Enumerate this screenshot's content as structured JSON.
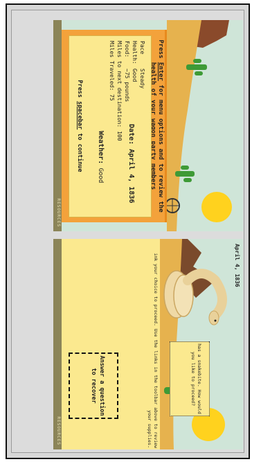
{
  "screen_travel": {
    "prompt_prefix": "Press ",
    "prompt_key": "Enter",
    "prompt_suffix": " for menu options and to review the health of your wagon party members",
    "stats": [
      {
        "label": "Pace",
        "value": "Steady"
      },
      {
        "label": "Health:",
        "value": "Good"
      },
      {
        "label": "Food:",
        "value": "~75 pounds"
      },
      {
        "label": "Miles to next destination:",
        "value": "100"
      },
      {
        "label": "Miles Traveled:",
        "value": "75"
      }
    ],
    "date_label": "Date: April 4, 1836",
    "weather_label": "Weather:",
    "weather_value": "Good",
    "continue_prefix": "Press ",
    "continue_key": "spacebar",
    "continue_suffix": " to continue",
    "footer": "RESOURCES"
  },
  "screen_event": {
    "date": "April 4, 1836",
    "message": "has a snakebite. How would you like to proceed?",
    "instructions": "ink  your choice to proceed. Use the links in the toolbar above to review your supplies.",
    "answer_prompt": "Answer a question to recover",
    "footer": "RESOURCES"
  },
  "colors": {
    "sky": "#cfe5d8",
    "sand": "#e6b24e",
    "panel": "#fbe98f",
    "orange": "#f3a23b",
    "cactus": "#3e9a36",
    "sun": "#ffd21e"
  },
  "icons": [
    "cactus-icon",
    "sun-icon",
    "wagon-wheel-icon",
    "rattlesnake-icon"
  ]
}
